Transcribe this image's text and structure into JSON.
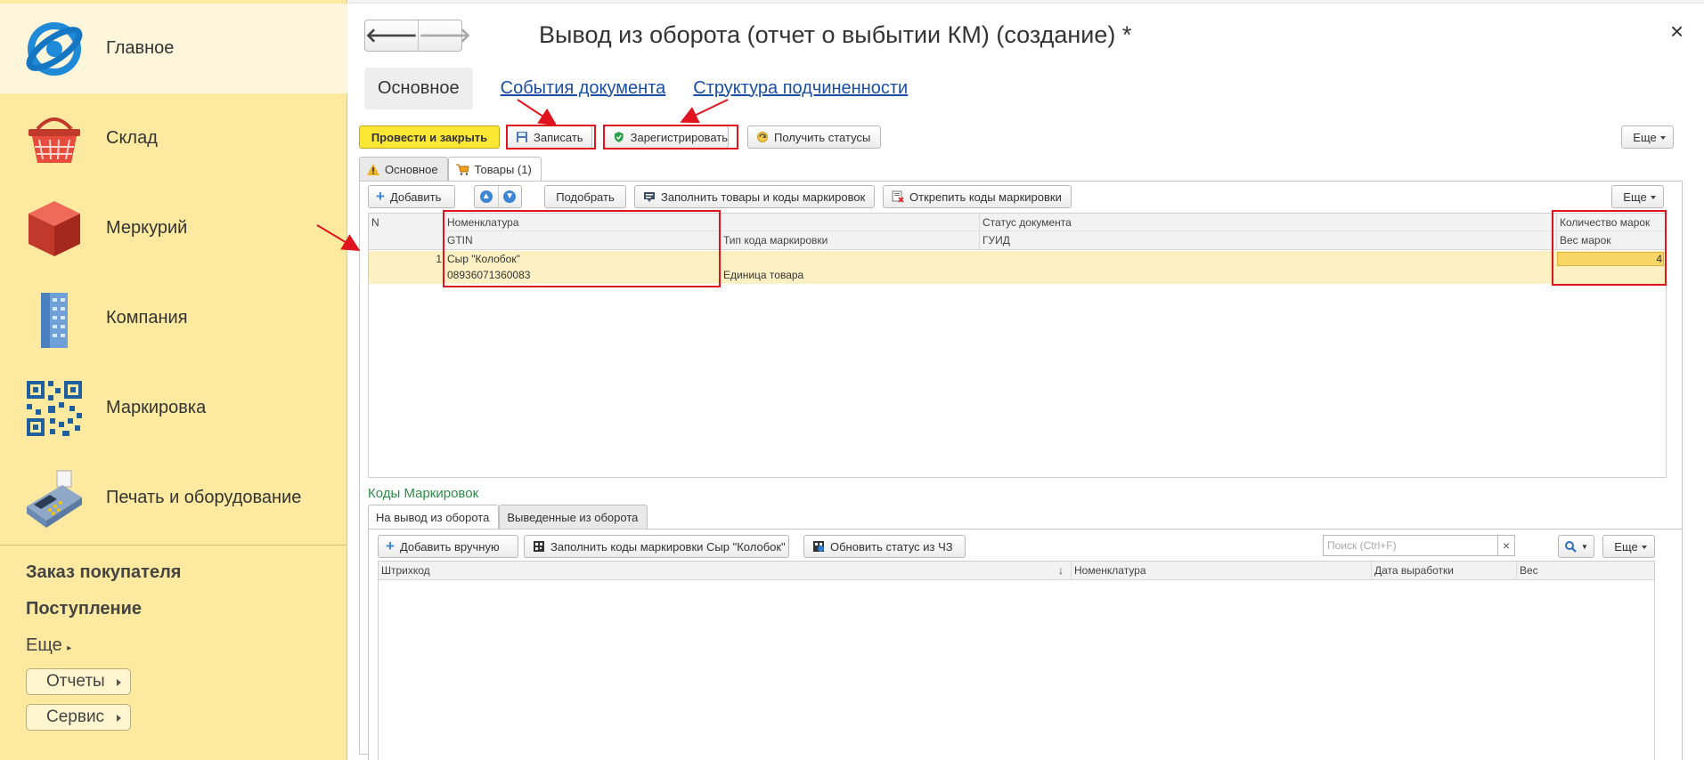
{
  "sidebar": {
    "items": [
      {
        "label": "Главное",
        "icon": "globe-icon"
      },
      {
        "label": "Склад",
        "icon": "basket-icon"
      },
      {
        "label": "Меркурий",
        "icon": "cube-icon"
      },
      {
        "label": "Компания",
        "icon": "building-icon"
      },
      {
        "label": "Маркировка",
        "icon": "qr-code-icon"
      },
      {
        "label": "Печать и оборудование",
        "icon": "pos-terminal-icon"
      }
    ],
    "links": [
      "Заказ покупателя",
      "Поступление"
    ],
    "more": "Еще",
    "buttons": [
      "Отчеты",
      "Сервис"
    ]
  },
  "window": {
    "title": "Вывод из оборота (отчет о выбытии КМ) (создание) *",
    "close": "×",
    "back": "🡐",
    "forward": "🡒"
  },
  "tabs": [
    "Основное",
    "События документа",
    "Структура подчиненности"
  ],
  "toolbar": {
    "post_close": "Провести и закрыть",
    "save": "Записать",
    "register": "Зарегистрировать",
    "get_status": "Получить статусы",
    "more": "Еще"
  },
  "inner_tabs": [
    "Основное",
    "Товары (1)"
  ],
  "goods_toolbar": {
    "add": "Добавить",
    "pick": "Подобрать",
    "fill": "Заполнить товары и коды маркировок",
    "detach": "Открепить коды маркировки",
    "more": "Еще"
  },
  "goods_table": {
    "headers_row1": [
      "N",
      "Номенклатура",
      "",
      "Статус документа",
      "Количество марок"
    ],
    "headers_row2": [
      "",
      "GTIN",
      "Тип кода маркировки",
      "ГУИД",
      "Вес марок"
    ],
    "rows": [
      {
        "n": "1",
        "nomenclature": "Сыр \"Колобок\"",
        "gtin": "08936071360083",
        "code_type": "Единица товара",
        "status": "",
        "guid": "",
        "qty": "4",
        "weight": ""
      }
    ]
  },
  "codes": {
    "title": "Коды Маркировок",
    "tabs": [
      "На вывод из оборота",
      "Выведенные из оборота"
    ],
    "toolbar": {
      "add_manual": "Добавить вручную",
      "fill_codes": "Заполнить коды маркировки Сыр \"Колобок\"",
      "refresh": "Обновить статус из ЧЗ",
      "search_placeholder": "Поиск (Ctrl+F)",
      "clear": "×",
      "more": "Еще"
    },
    "headers": [
      "Штрихкод",
      "↓",
      "Номенклатура",
      "Дата выработки",
      "Вес"
    ]
  },
  "colors": {
    "sidebar_bg": "#fdeaa0",
    "accent_yellow": "#fbe634",
    "link_blue": "#1a4ea6",
    "highlight_red": "#e0141e",
    "row_selected": "#fdf1c4",
    "section_green": "#2e8b46"
  }
}
